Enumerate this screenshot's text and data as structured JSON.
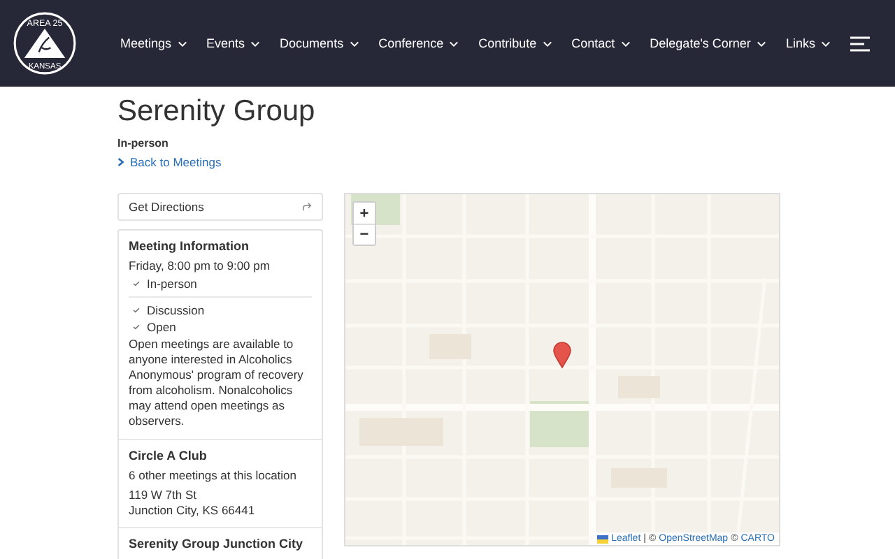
{
  "logo": {
    "top": "AREA 25",
    "bottom": "KANSAS"
  },
  "nav": [
    {
      "label": "Meetings"
    },
    {
      "label": "Events"
    },
    {
      "label": "Documents"
    },
    {
      "label": "Conference"
    },
    {
      "label": "Contribute"
    },
    {
      "label": "Contact"
    },
    {
      "label": "Delegate's Corner"
    },
    {
      "label": "Links"
    }
  ],
  "title": "Serenity Group",
  "attendance": "In-person",
  "back_link": "Back to Meetings",
  "directions": "Get Directions",
  "meeting_info": {
    "heading": "Meeting Information",
    "time": "Friday, 8:00 pm to 9:00 pm",
    "type_groups": [
      [
        "In-person"
      ],
      [
        "Discussion",
        "Open"
      ]
    ],
    "description": "Open meetings are available to anyone interested in Alcoholics Anonymous' program of recovery from alcoholism. Nonalcoholics may attend open meetings as observers."
  },
  "location": {
    "name": "Circle A Club",
    "other_meetings": "6 other meetings at this location",
    "address_lines": [
      "119 W 7th St",
      "Junction City, KS 66441"
    ]
  },
  "group": {
    "name": "Serenity Group Junction City"
  },
  "map": {
    "zoom_in": "+",
    "zoom_out": "−",
    "attribution": [
      {
        "kind": "link",
        "text": "Leaflet"
      },
      {
        "kind": "text",
        "text": "|"
      },
      {
        "kind": "text",
        "text": "©"
      },
      {
        "kind": "link",
        "text": "OpenStreetMap"
      },
      {
        "kind": "text",
        "text": "©"
      },
      {
        "kind": "link",
        "text": "CARTO"
      }
    ]
  }
}
